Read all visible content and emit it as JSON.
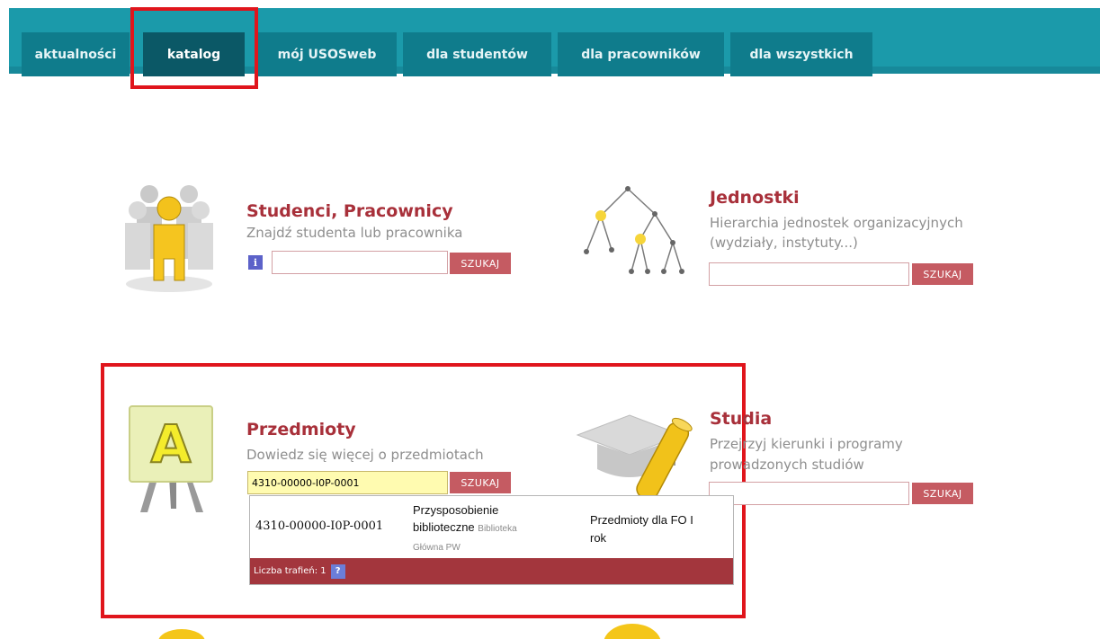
{
  "nav": {
    "tabs": [
      {
        "label": "aktualności"
      },
      {
        "label": "katalog",
        "active": true
      },
      {
        "label": "mój USOSweb"
      },
      {
        "label": "dla studentów"
      },
      {
        "label": "dla pracowników"
      },
      {
        "label": "dla wszystkich"
      }
    ]
  },
  "people": {
    "title": "Studenci, Pracownicy",
    "description": "Znajdź studenta lub pracownika",
    "info_icon": "i",
    "search_value": "",
    "button": "SZUKAJ"
  },
  "units": {
    "title": "Jednostki",
    "description_1": "Hierarchia jednostek organizacyjnych",
    "description_2": "(wydziały, instytuty...)",
    "search_value": "",
    "button": "SZUKAJ"
  },
  "courses": {
    "title": "Przedmioty",
    "description": "Dowiedz się więcej o przedmiotach",
    "search_value": "4310-00000-I0P-0001",
    "button": "SZUKAJ"
  },
  "studies": {
    "title": "Studia",
    "description_1": "Przejrzyj kierunki i programy",
    "description_2": "prowadzonych studiów",
    "search_value": "",
    "button": "SZUKAJ"
  },
  "dropdown": {
    "code": "4310-00000-I0P-0001",
    "name_1": "Przysposobienie",
    "name_2": "biblioteczne",
    "unit_1": "Biblioteka",
    "unit_2": "Główna PW",
    "group_1": "Przedmioty dla FO I",
    "group_2": "rok",
    "hits_label": "Liczba trafień: 1",
    "help_icon": "?"
  },
  "colors": {
    "nav_bg": "#1b9aaa",
    "tab_bg": "#0f7c8c",
    "tab_active": "#0b5866",
    "title_red": "#a8303a",
    "button_red": "#c55b62",
    "highlight": "#e0151c"
  }
}
